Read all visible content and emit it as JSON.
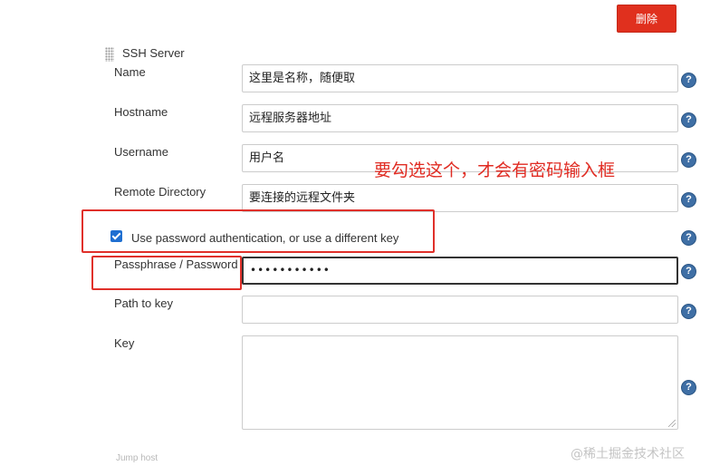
{
  "toolbar": {
    "delete_label": "删除"
  },
  "section": {
    "title": "SSH Server"
  },
  "fields": {
    "name": {
      "label": "Name",
      "value": "这里是名称，随便取"
    },
    "hostname": {
      "label": "Hostname",
      "value": "远程服务器地址"
    },
    "username": {
      "label": "Username",
      "value": "用户名"
    },
    "remote_directory": {
      "label": "Remote Directory",
      "value": "要连接的远程文件夹"
    },
    "use_password": {
      "label": "Use password authentication, or use a different key",
      "checked": true
    },
    "passphrase": {
      "label": "Passphrase / Password",
      "value": "•••••••••••"
    },
    "path_to_key": {
      "label": "Path to key",
      "value": ""
    },
    "key": {
      "label": "Key",
      "value": ""
    }
  },
  "help": {
    "glyph": "?"
  },
  "annotation": {
    "text": "要勾选这个，才会有密码输入框",
    "color": "#e02b22"
  },
  "footer": {
    "cut_label": "Jump host",
    "watermark": "@稀土掘金技术社区"
  },
  "colors": {
    "delete_button": "#e0301e",
    "help_icon": "#3f6fa5",
    "checkbox": "#1f6fd1",
    "annotation": "#e0302a"
  }
}
